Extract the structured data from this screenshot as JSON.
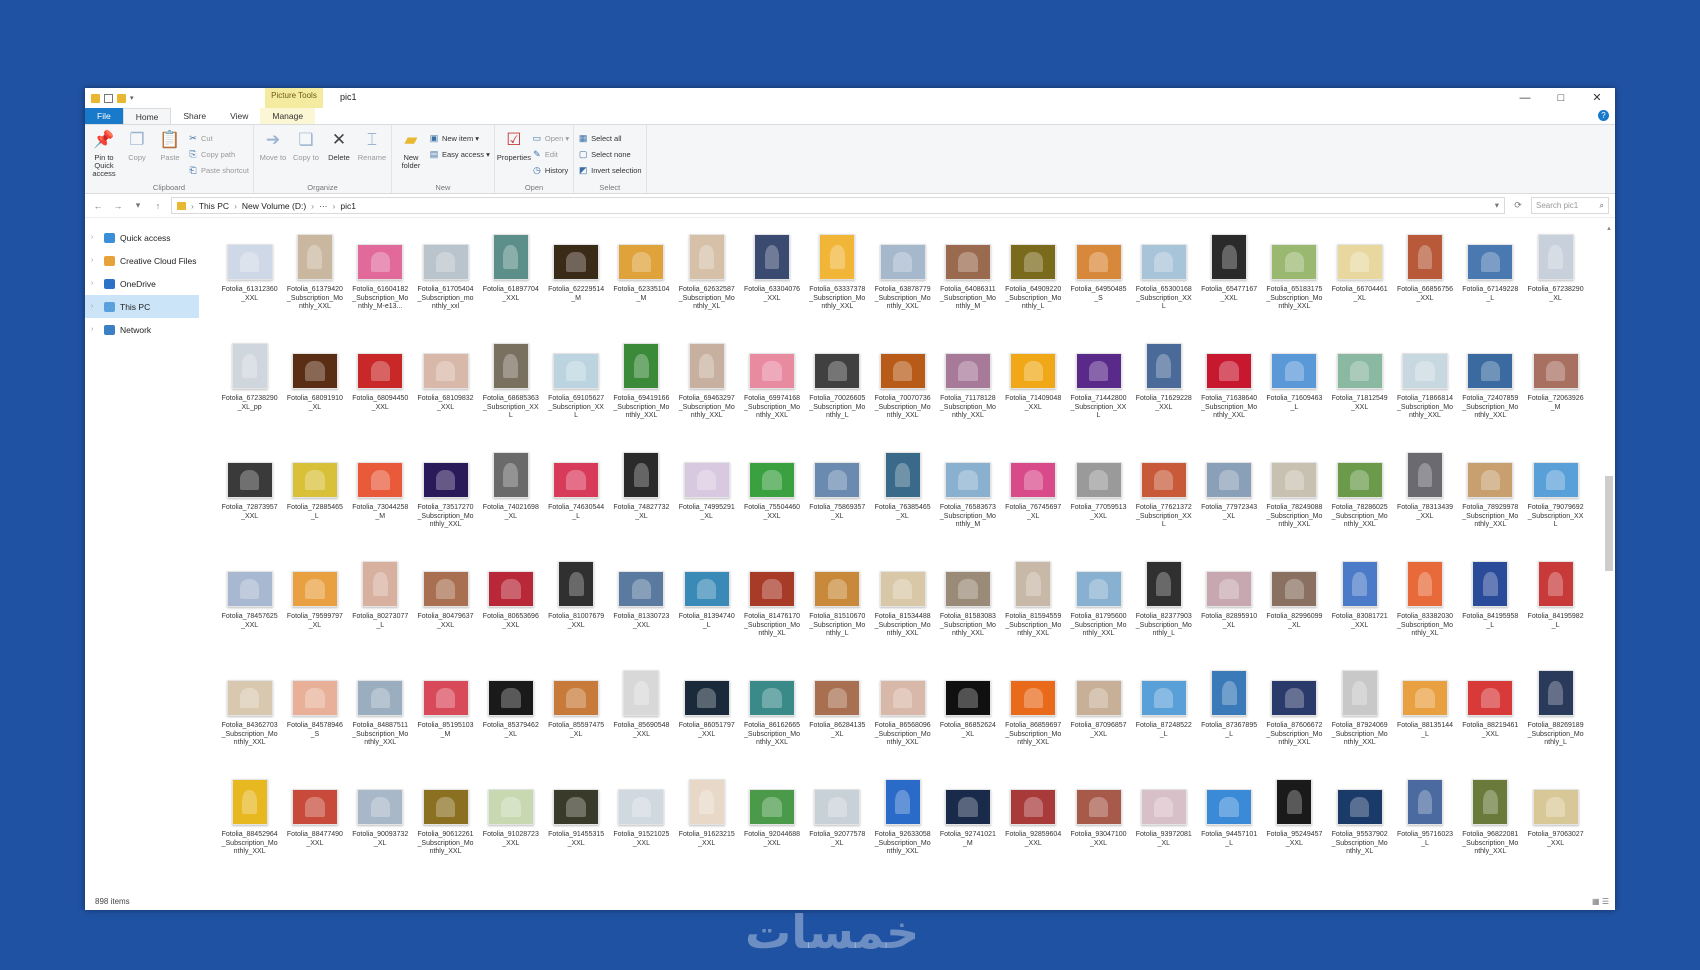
{
  "titlebar": {
    "context_tab": "Picture Tools",
    "title": "pic1",
    "minimize": "—",
    "maximize": "□",
    "close": "✕"
  },
  "tabs": [
    {
      "label": "File"
    },
    {
      "label": "Home"
    },
    {
      "label": "Share"
    },
    {
      "label": "View"
    },
    {
      "label": "Manage"
    }
  ],
  "help": "?",
  "ribbon": {
    "clipboard": {
      "label": "Clipboard",
      "pin": "Pin to Quick access",
      "copy": "Copy",
      "paste": "Paste",
      "cut": "Cut",
      "copy_path": "Copy path",
      "paste_shortcut": "Paste shortcut"
    },
    "organize": {
      "label": "Organize",
      "move_to": "Move to",
      "copy_to": "Copy to",
      "delete": "Delete",
      "rename": "Rename"
    },
    "new": {
      "label": "New",
      "new_folder": "New folder",
      "new_item": "New item ▾",
      "easy_access": "Easy access ▾"
    },
    "open": {
      "label": "Open",
      "properties": "Properties",
      "open": "Open ▾",
      "edit": "Edit",
      "history": "History"
    },
    "select": {
      "label": "Select",
      "select_all": "Select all",
      "select_none": "Select none",
      "invert": "Invert selection"
    }
  },
  "address": {
    "parts": [
      "This PC",
      "New Volume (D:)",
      "···",
      "pic1"
    ],
    "search_placeholder": "Search pic1"
  },
  "nav": [
    {
      "label": "Quick access",
      "color": "#3b8fd9"
    },
    {
      "label": "Creative Cloud Files",
      "color": "#e8a23a"
    },
    {
      "label": "OneDrive",
      "color": "#2c72c7"
    },
    {
      "label": "This PC",
      "color": "#5aa0dc"
    },
    {
      "label": "Network",
      "color": "#3b7fc4"
    }
  ],
  "status": {
    "count": "898 items",
    "views": "▦ ☰"
  },
  "watermark": "خمسات",
  "files": [
    {
      "name": "Fotolia_61312360_XXL",
      "c": "#cfd8e6",
      "t": 0
    },
    {
      "name": "Fotolia_61379420_Subscription_Monthly_XXL",
      "c": "#c9b7a0",
      "t": 1
    },
    {
      "name": "Fotolia_61604182_Subscription_Monthly_M-e13...",
      "c": "#e16a9a",
      "t": 0
    },
    {
      "name": "Fotolia_61705404_Subscription_monthly_xxl",
      "c": "#b9c4cc",
      "t": 0
    },
    {
      "name": "Fotolia_61897704_XXL",
      "c": "#5d8f8a",
      "t": 1
    },
    {
      "name": "Fotolia_62229514_M",
      "c": "#3a2a18",
      "t": 0
    },
    {
      "name": "Fotolia_62335104_M",
      "c": "#e0a23a",
      "t": 0
    },
    {
      "name": "Fotolia_62632587_Subscription_Monthly_XL",
      "c": "#d6c0a8",
      "t": 1
    },
    {
      "name": "Fotolia_63304076_XXL",
      "c": "#3a4a70",
      "t": 1
    },
    {
      "name": "Fotolia_63337378_Subscription_Monthly_XXL",
      "c": "#f1b538",
      "t": 1
    },
    {
      "name": "Fotolia_63878779_Subscription_Monthly_XXL",
      "c": "#a6b8cc",
      "t": 0
    },
    {
      "name": "Fotolia_64086311_Subscription_Monthly_M",
      "c": "#9a6a4e",
      "t": 0
    },
    {
      "name": "Fotolia_64909220_Subscription_Monthly_L",
      "c": "#7a6a1c",
      "t": 0
    },
    {
      "name": "Fotolia_64950485_S",
      "c": "#d8883a",
      "t": 0
    },
    {
      "name": "Fotolia_65300168_Subscription_XXL",
      "c": "#a8c4d8",
      "t": 0
    },
    {
      "name": "Fotolia_65477167_XXL",
      "c": "#2a2a2a",
      "t": 1
    },
    {
      "name": "Fotolia_65183175_Subscription_Monthly_XXL",
      "c": "#9ab870",
      "t": 0
    },
    {
      "name": "Fotolia_66704461_XL",
      "c": "#e8d8a0",
      "t": 0
    },
    {
      "name": "Fotolia_66856756_XXL",
      "c": "#b85a3a",
      "t": 1
    },
    {
      "name": "Fotolia_67149228_L",
      "c": "#4a78b0",
      "t": 0
    },
    {
      "name": "Fotolia_67238290_XL",
      "c": "#c8d0dc",
      "t": 1
    },
    {
      "name": "Fotolia_67238290_XL_pp",
      "c": "#d0d6de",
      "t": 1
    },
    {
      "name": "Fotolia_68091910_XL",
      "c": "#5a2e14",
      "t": 0
    },
    {
      "name": "Fotolia_68094450_XXL",
      "c": "#c82828",
      "t": 0
    },
    {
      "name": "Fotolia_68109832_XXL",
      "c": "#d8b8a8",
      "t": 0
    },
    {
      "name": "Fotolia_68685363_Subscription_XXL",
      "c": "#7a7060",
      "t": 1
    },
    {
      "name": "Fotolia_69105627_Subscription_XXL",
      "c": "#bcd4e0",
      "t": 0
    },
    {
      "name": "Fotolia_69419166_Subscription_Monthly_XXL",
      "c": "#3a8a3a",
      "t": 1
    },
    {
      "name": "Fotolia_69463297_Subscription_Monthly_XXL",
      "c": "#c8b0a0",
      "t": 1
    },
    {
      "name": "Fotolia_69974168_Subscription_Monthly_XXL",
      "c": "#e88aa0",
      "t": 0
    },
    {
      "name": "Fotolia_70026605_Subscription_Monthly_L",
      "c": "#404040",
      "t": 0
    },
    {
      "name": "Fotolia_70070736_Subscription_Monthly_XXL",
      "c": "#b85a18",
      "t": 0
    },
    {
      "name": "Fotolia_71178128_Subscription_Monthly_XXL",
      "c": "#a87a9a",
      "t": 0
    },
    {
      "name": "Fotolia_71409048_XXL",
      "c": "#f0a818",
      "t": 0
    },
    {
      "name": "Fotolia_71442800_Subscription_XXL",
      "c": "#5a2a8a",
      "t": 0
    },
    {
      "name": "Fotolia_71629228_XXL",
      "c": "#4a6a9a",
      "t": 1
    },
    {
      "name": "Fotolia_71638640_Subscription_Monthly_XXL",
      "c": "#c81830",
      "t": 0
    },
    {
      "name": "Fotolia_71609463_L",
      "c": "#5a98d8",
      "t": 0
    },
    {
      "name": "Fotolia_71812549_XXL",
      "c": "#8ab8a0",
      "t": 0
    },
    {
      "name": "Fotolia_71866814_Subscription_Monthly_XXL",
      "c": "#c8d8e0",
      "t": 0
    },
    {
      "name": "Fotolia_72407859_Subscription_Monthly_XXL",
      "c": "#3a6aa0",
      "t": 0
    },
    {
      "name": "Fotolia_72063926_M",
      "c": "#a87060",
      "t": 0
    },
    {
      "name": "Fotolia_72873957_XXL",
      "c": "#3a3a3a",
      "t": 0
    },
    {
      "name": "Fotolia_72885465_L",
      "c": "#d8c038",
      "t": 0
    },
    {
      "name": "Fotolia_73044258_M",
      "c": "#e85a3a",
      "t": 0
    },
    {
      "name": "Fotolia_73517270_Subscription_Monthly_XXL",
      "c": "#2a1a5a",
      "t": 0
    },
    {
      "name": "Fotolia_74021698_XL",
      "c": "#6a6a6a",
      "t": 1
    },
    {
      "name": "Fotolia_74630544_L",
      "c": "#d83a5a",
      "t": 0
    },
    {
      "name": "Fotolia_74827732_XL",
      "c": "#2a2a2a",
      "t": 1
    },
    {
      "name": "Fotolia_74995291_XL",
      "c": "#d8c8e0",
      "t": 0
    },
    {
      "name": "Fotolia_75504460_XXL",
      "c": "#3aa040",
      "t": 0
    },
    {
      "name": "Fotolia_75869357_XL",
      "c": "#6a8ab0",
      "t": 0
    },
    {
      "name": "Fotolia_76385465_XL",
      "c": "#3a6a8a",
      "t": 1
    },
    {
      "name": "Fotolia_76583673_Subscription_Monthly_M",
      "c": "#8ab0d0",
      "t": 0
    },
    {
      "name": "Fotolia_76745697_XL",
      "c": "#d84a8a",
      "t": 0
    },
    {
      "name": "Fotolia_77059513_XXL",
      "c": "#9a9a9a",
      "t": 0
    },
    {
      "name": "Fotolia_77621372_Subscription_XXL",
      "c": "#c85a3a",
      "t": 0
    },
    {
      "name": "Fotolia_77972343_XL",
      "c": "#8aa0b8",
      "t": 0
    },
    {
      "name": "Fotolia_78249088_Subscription_Monthly_XXL",
      "c": "#c8c0b0",
      "t": 0
    },
    {
      "name": "Fotolia_78286025_Subscription_Monthly_XXL",
      "c": "#6a9a4a",
      "t": 0
    },
    {
      "name": "Fotolia_78313439_XXL",
      "c": "#6a6a70",
      "t": 1
    },
    {
      "name": "Fotolia_78929978_Subscription_Monthly_XXL",
      "c": "#c8a070",
      "t": 0
    },
    {
      "name": "Fotolia_79079692_Subscription_XXL",
      "c": "#5aa0d8",
      "t": 0
    },
    {
      "name": "Fotolia_78457625_XXL",
      "c": "#a8b8d0",
      "t": 0
    },
    {
      "name": "Fotolia_79599797_XL",
      "c": "#e8a040",
      "t": 0
    },
    {
      "name": "Fotolia_80273077_L",
      "c": "#d8b0a0",
      "t": 1
    },
    {
      "name": "Fotolia_80479637_XXL",
      "c": "#a87050",
      "t": 0
    },
    {
      "name": "Fotolia_80653696_XXL",
      "c": "#b82838",
      "t": 0
    },
    {
      "name": "Fotolia_81007679_XXL",
      "c": "#303030",
      "t": 1
    },
    {
      "name": "Fotolia_81330723_XXL",
      "c": "#5a7aa0",
      "t": 0
    },
    {
      "name": "Fotolia_81394740_L",
      "c": "#3a8ab8",
      "t": 0
    },
    {
      "name": "Fotolia_81476170_Subscription_Monthly_XL",
      "c": "#a83a28",
      "t": 0
    },
    {
      "name": "Fotolia_81510670_Subscription_Monthly_L",
      "c": "#c88a3a",
      "t": 0
    },
    {
      "name": "Fotolia_81534488_Subscription_Monthly_XXL",
      "c": "#d8c8a8",
      "t": 0
    },
    {
      "name": "Fotolia_81583083_Subscription_Monthly_XXL",
      "c": "#9a8a78",
      "t": 0
    },
    {
      "name": "Fotolia_81594559_Subscription_Monthly_XXL",
      "c": "#c8b8a8",
      "t": 1
    },
    {
      "name": "Fotolia_81795600_Subscription_Monthly_XXL",
      "c": "#88b0d0",
      "t": 0
    },
    {
      "name": "Fotolia_82377903_Subscription_Monthly_L",
      "c": "#303030",
      "t": 1
    },
    {
      "name": "Fotolia_82895910_XL",
      "c": "#c8a8b0",
      "t": 0
    },
    {
      "name": "Fotolia_82996099_XL",
      "c": "#8a7060",
      "t": 0
    },
    {
      "name": "Fotolia_83081721_XXL",
      "c": "#4a7ac8",
      "t": 1
    },
    {
      "name": "Fotolia_83382030_Subscription_Monthly_XL",
      "c": "#e86a3a",
      "t": 1
    },
    {
      "name": "Fotolia_84195958_L",
      "c": "#2a4a9a",
      "t": 1
    },
    {
      "name": "Fotolia_84195982_L",
      "c": "#c83a3a",
      "t": 1
    },
    {
      "name": "Fotolia_84362703_Subscription_Monthly_XXL",
      "c": "#d8c8b0",
      "t": 0
    },
    {
      "name": "Fotolia_84578946_S",
      "c": "#e8b098",
      "t": 0
    },
    {
      "name": "Fotolia_84887511_Subscription_Monthly_XXL",
      "c": "#9aaec0",
      "t": 0
    },
    {
      "name": "Fotolia_85195103_M",
      "c": "#d84a5a",
      "t": 0
    },
    {
      "name": "Fotolia_85379462_XL",
      "c": "#1a1a1a",
      "t": 0
    },
    {
      "name": "Fotolia_85597475_XL",
      "c": "#c87a3a",
      "t": 0
    },
    {
      "name": "Fotolia_85690548_XXL",
      "c": "#d8d8d8",
      "t": 1
    },
    {
      "name": "Fotolia_86051797_XXL",
      "c": "#1a2a3a",
      "t": 0
    },
    {
      "name": "Fotolia_86162665_Subscription_Monthly_XXL",
      "c": "#3a8a8a",
      "t": 0
    },
    {
      "name": "Fotolia_86284135_XL",
      "c": "#a87050",
      "t": 0
    },
    {
      "name": "Fotolia_86568096_Subscription_Monthly_XXL",
      "c": "#d8b8a8",
      "t": 0
    },
    {
      "name": "Fotolia_86852624_XL",
      "c": "#101010",
      "t": 0
    },
    {
      "name": "Fotolia_86859697_Subscription_Monthly_XXL",
      "c": "#e86a1a",
      "t": 0
    },
    {
      "name": "Fotolia_87096857_XXL",
      "c": "#c8b098",
      "t": 0
    },
    {
      "name": "Fotolia_87248522_L",
      "c": "#5aa0d8",
      "t": 0
    },
    {
      "name": "Fotolia_87367895_L",
      "c": "#3a7ab8",
      "t": 1
    },
    {
      "name": "Fotolia_87606672_Subscription_Monthly_XXL",
      "c": "#2a3a6a",
      "t": 0
    },
    {
      "name": "Fotolia_87924069_Subscription_Monthly_XXL",
      "c": "#c8c8c8",
      "t": 1
    },
    {
      "name": "Fotolia_88135144_L",
      "c": "#e8a040",
      "t": 0
    },
    {
      "name": "Fotolia_88219461_XXL",
      "c": "#d83a3a",
      "t": 0
    },
    {
      "name": "Fotolia_88269189_Subscription_Monthly_L",
      "c": "#2a3a5a",
      "t": 1
    },
    {
      "name": "Fotolia_88452964_Subscription_Monthly_XXL",
      "c": "#e8b820",
      "t": 1
    },
    {
      "name": "Fotolia_88477490_XXL",
      "c": "#c84a3a",
      "t": 0
    },
    {
      "name": "Fotolia_90093732_XL",
      "c": "#a8b8c8",
      "t": 0
    },
    {
      "name": "Fotolia_90612261_Subscription_Monthly_XXL",
      "c": "#8a7020",
      "t": 0
    },
    {
      "name": "Fotolia_91028723_XXL",
      "c": "#c8d8b0",
      "t": 0
    },
    {
      "name": "Fotolia_91455315_XXL",
      "c": "#3a3a2a",
      "t": 0
    },
    {
      "name": "Fotolia_91521025_XXL",
      "c": "#d0d8e0",
      "t": 0
    },
    {
      "name": "Fotolia_91623215_XXL",
      "c": "#e8d8c8",
      "t": 1
    },
    {
      "name": "Fotolia_92044688_XXL",
      "c": "#4a9a4a",
      "t": 0
    },
    {
      "name": "Fotolia_92077578_XL",
      "c": "#c8d0d8",
      "t": 0
    },
    {
      "name": "Fotolia_92633058_Subscription_Monthly_XXL",
      "c": "#2a6ac8",
      "t": 1
    },
    {
      "name": "Fotolia_92741021_M",
      "c": "#1a2a4a",
      "t": 0
    },
    {
      "name": "Fotolia_92859604_XXL",
      "c": "#a83a3a",
      "t": 0
    },
    {
      "name": "Fotolia_93047100_XXL",
      "c": "#a85a4a",
      "t": 0
    },
    {
      "name": "Fotolia_93972081_XL",
      "c": "#d8c0c8",
      "t": 0
    },
    {
      "name": "Fotolia_94457101_L",
      "c": "#3a8ad8",
      "t": 0
    },
    {
      "name": "Fotolia_95249457_XXL",
      "c": "#1a1a1a",
      "t": 1
    },
    {
      "name": "Fotolia_95537902_Subscription_Monthly_XL",
      "c": "#1a3a6a",
      "t": 0
    },
    {
      "name": "Fotolia_95716023_L",
      "c": "#4a6aa0",
      "t": 1
    },
    {
      "name": "Fotolia_96822081_Subscription_Monthly_XXL",
      "c": "#6a7a3a",
      "t": 1
    },
    {
      "name": "Fotolia_97063027_XXL",
      "c": "#d8c898",
      "t": 0
    }
  ]
}
